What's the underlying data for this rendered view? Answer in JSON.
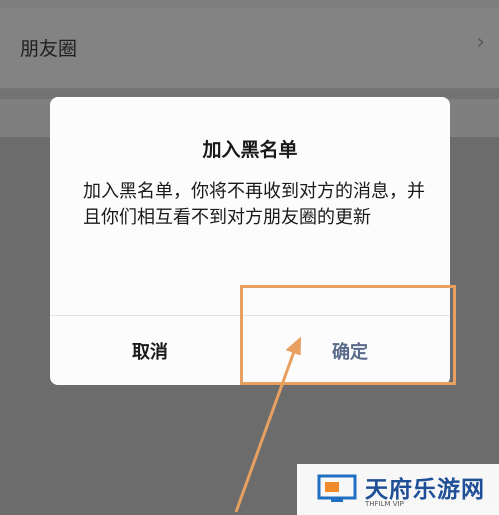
{
  "background_list": {
    "row_label": "朋友圈",
    "row_chevron_icon": "chevron-right-icon"
  },
  "dialog": {
    "title": "加入黑名单",
    "message": "加入黑名单，你将不再收到对方的消息，并且你们相互看不到对方朋友圈的更新",
    "cancel_label": "取消",
    "confirm_label": "确定",
    "confirm_color": "#5a6a8a"
  },
  "annotation": {
    "highlight_color": "#e8a060"
  },
  "watermark": {
    "brand": "天府乐游网",
    "sub": "THFILM VIP"
  }
}
